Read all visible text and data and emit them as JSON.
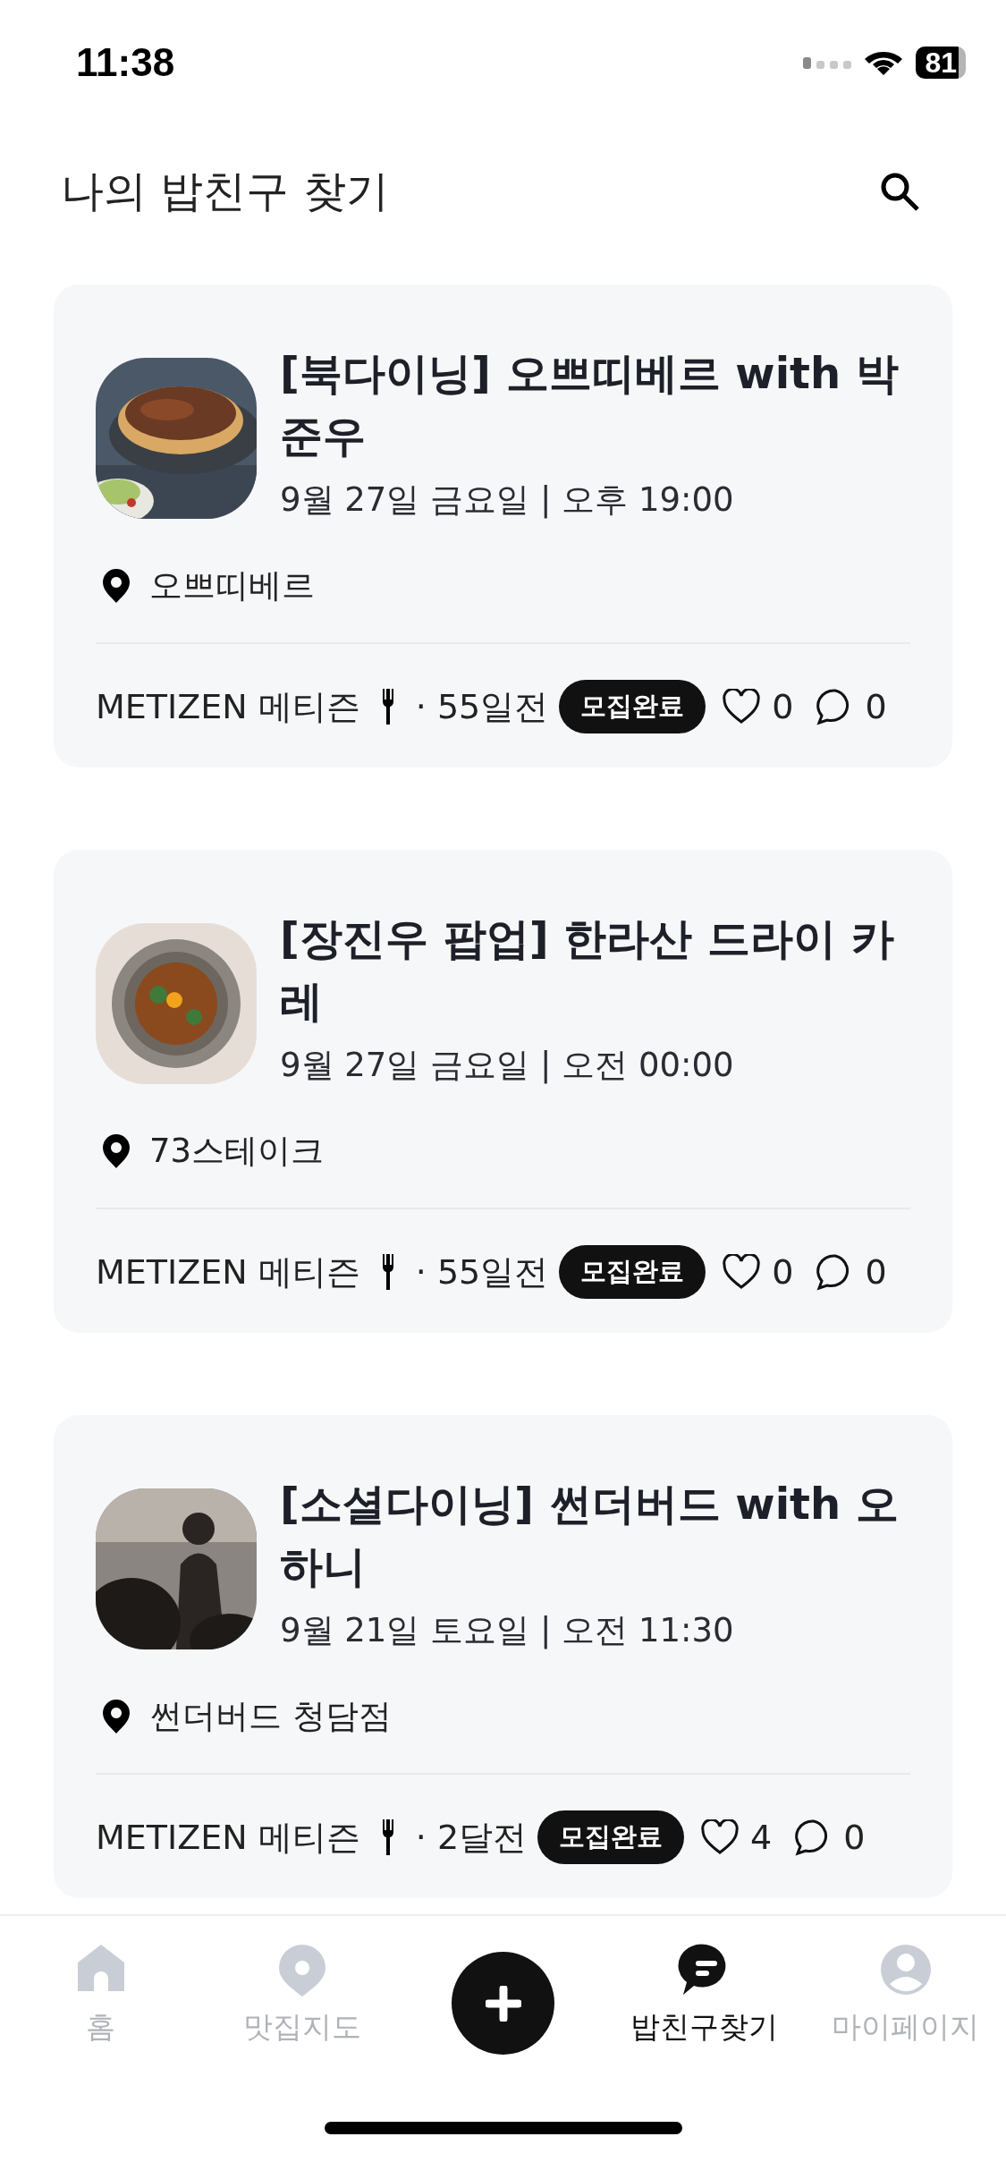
{
  "status_bar": {
    "time": "11:38",
    "battery": "81"
  },
  "header": {
    "title": "나의 밥친구 찾기"
  },
  "posts": [
    {
      "title": "[북다이닝] 오쁘띠베르 with 박준우",
      "date": "9월 27일 금요일 | 오후 19:00",
      "location": "오쁘띠베르",
      "author": "METIZEN 메티즌",
      "ago": "· 55일전",
      "badge": "모집완료",
      "likes": "0",
      "comments": "0"
    },
    {
      "title": "[장진우 팝업] 한라산 드라이 카레",
      "date": "9월 27일 금요일 | 오전 00:00",
      "location": "73스테이크",
      "author": "METIZEN 메티즌",
      "ago": "· 55일전",
      "badge": "모집완료",
      "likes": "0",
      "comments": "0"
    },
    {
      "title": "[소셜다이닝] 썬더버드 with 오하니",
      "date": "9월 21일 토요일 | 오전 11:30",
      "location": "썬더버드 청담점",
      "author": "METIZEN 메티즌",
      "ago": "· 2달전",
      "badge": "모집완료",
      "likes": "4",
      "comments": "0"
    }
  ],
  "tab_bar": [
    {
      "kind": "home",
      "label": "홈",
      "selected": false
    },
    {
      "kind": "map",
      "label": "맛집지도",
      "selected": false
    },
    {
      "kind": "add",
      "selected": false
    },
    {
      "kind": "chat",
      "label": "밥친구찾기",
      "selected": true
    },
    {
      "kind": "profile",
      "label": "마이페이지",
      "selected": false
    }
  ]
}
